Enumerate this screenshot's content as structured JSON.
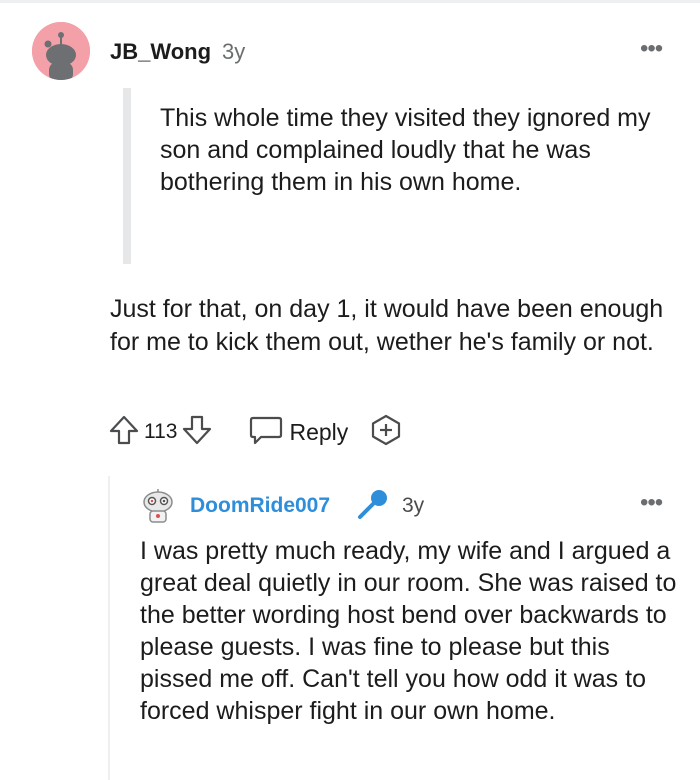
{
  "comment": {
    "username": "JB_Wong",
    "age": "3y",
    "quote": "This whole time they visited they ignored my son and complained loudly that he was bothering them in his own home.",
    "body": "Just for that, on day 1, it would have been enough for me to kick them out, wether he's family or not.",
    "score": "113",
    "reply_label": "Reply"
  },
  "reply": {
    "username": "DoomRide007",
    "age": "3y",
    "body": "I was pretty much ready, my wife and I argued a great deal quietly in our room. She was raised to the better wording host bend over backwards to please guests. I was fine to please but this pissed me off. Can't tell you how odd it was to forced whisper fight in our own home."
  },
  "icons": {
    "avatar": "snoo-avatar-icon",
    "more": "more-options-icon",
    "upvote": "upvote-arrow-icon",
    "downvote": "downvote-arrow-icon",
    "reply": "reply-bubble-icon",
    "award": "award-plus-icon",
    "reply_avatar": "robot-snoo-avatar-icon",
    "mic": "microphone-icon"
  },
  "colors": {
    "avatar_bg": "#f4a0a8",
    "username_link": "#2f8ed9",
    "mic": "#2f8ed9"
  }
}
